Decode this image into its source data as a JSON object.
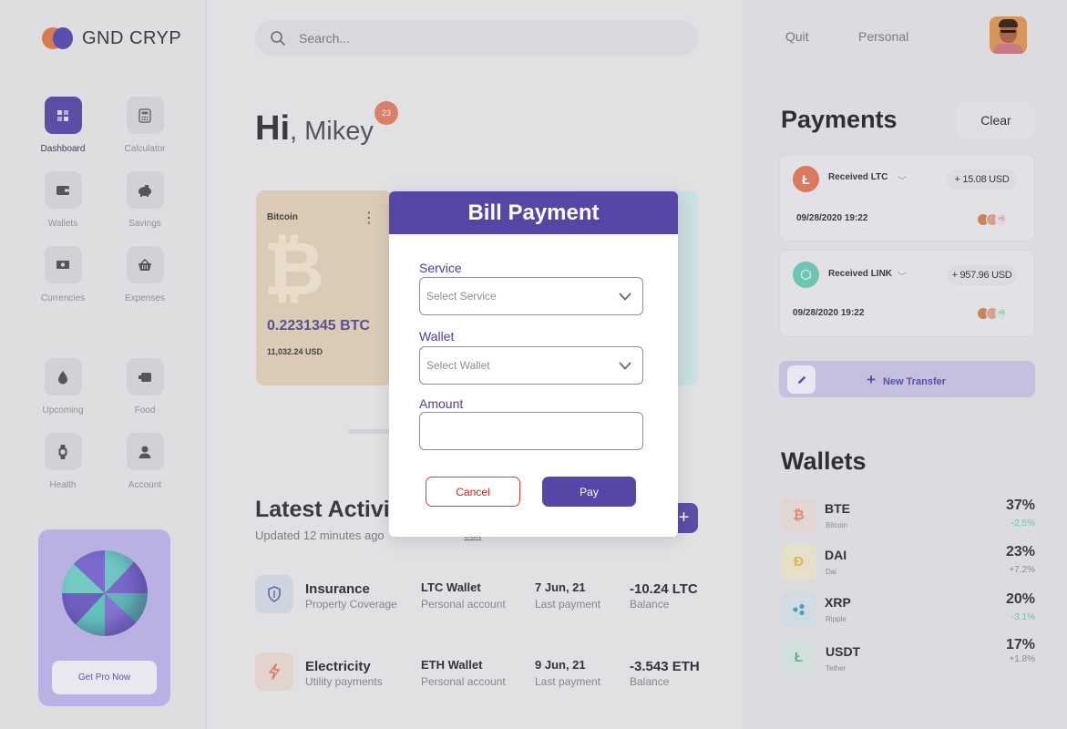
{
  "app": {
    "brand": "GND CRYP"
  },
  "sidebar": {
    "items": [
      {
        "label": "Dashboard"
      },
      {
        "label": "Calculator"
      },
      {
        "label": "Wallets"
      },
      {
        "label": "Savings"
      },
      {
        "label": "Currencies"
      },
      {
        "label": "Expenses"
      },
      {
        "label": "Upcoming"
      },
      {
        "label": "Food"
      },
      {
        "label": "Health"
      },
      {
        "label": "Account"
      }
    ],
    "promo_button": "Get Pro Now"
  },
  "search": {
    "placeholder": "Search..."
  },
  "greeting": {
    "hi": "Hi",
    "name": ", Mikey",
    "badge": "23"
  },
  "card": {
    "name": "Bitcoin",
    "symbol": "₿",
    "amount": "0.2231345 BTC",
    "usd": "11,032.24 USD"
  },
  "activity": {
    "title": "Latest Activi",
    "updated": "Updated 12 minutes ago",
    "edit": "edit",
    "add": "+",
    "rows": [
      {
        "title": "Insurance",
        "subtitle": "Property Coverage",
        "wallet": "LTC Wallet",
        "account": "Personal account",
        "date": "7 Jun, 21",
        "date_label": "Last payment",
        "amount": "-10.24 LTC",
        "amount_label": "Balance"
      },
      {
        "title": "Electricity",
        "subtitle": "Utility payments",
        "wallet": "ETH Wallet",
        "account": "Personal account",
        "date": "9 Jun, 21",
        "date_label": "Last payment",
        "amount": "-3.543 ETH",
        "amount_label": "Balance"
      }
    ]
  },
  "header": {
    "tab_quit": "Quit",
    "tab_personal": "Personal"
  },
  "payments": {
    "title": "Payments",
    "clear": "Clear",
    "items": [
      {
        "label": "Received LTC",
        "amount": "+ 15.08 USD",
        "datetime": "09/28/2020 19:22",
        "icon_glyph": "Ł",
        "more": "+5"
      },
      {
        "label": "Received LINK",
        "amount": "+ 957.96 USD",
        "datetime": "09/28/2020 19:22",
        "icon_glyph": "⬡",
        "more": "+5"
      }
    ],
    "new_transfer": "New Transfer"
  },
  "wallets": {
    "title": "Wallets",
    "items": [
      {
        "name": "BTE",
        "sub": "Bitcoin",
        "pct": "37%",
        "change": "-2.5%",
        "glyph": "₿",
        "change_color": "#6fc2a6"
      },
      {
        "name": "DAI",
        "sub": "Dai",
        "pct": "23%",
        "change": "+7.2%",
        "glyph": "Đ",
        "change_color": "#8a8a92"
      },
      {
        "name": "XRP",
        "sub": "Ripple",
        "pct": "20%",
        "change": "-3.1%",
        "glyph": "✕",
        "change_color": "#6fc2a6"
      },
      {
        "name": "USDT",
        "sub": "Tether",
        "pct": "17%",
        "change": "+1.8%",
        "glyph": "Ł",
        "change_color": "#8a8a92"
      }
    ]
  },
  "modal": {
    "title": "Bill Payment",
    "service_label": "Service",
    "service_placeholder": "Select Service",
    "wallet_label": "Wallet",
    "wallet_placeholder": "Select Wallet",
    "amount_label": "Amount",
    "amount_value": "",
    "cancel": "Cancel",
    "pay": "Pay"
  },
  "colors": {
    "accent": "#5646a6",
    "cancel": "#e53a2f"
  }
}
